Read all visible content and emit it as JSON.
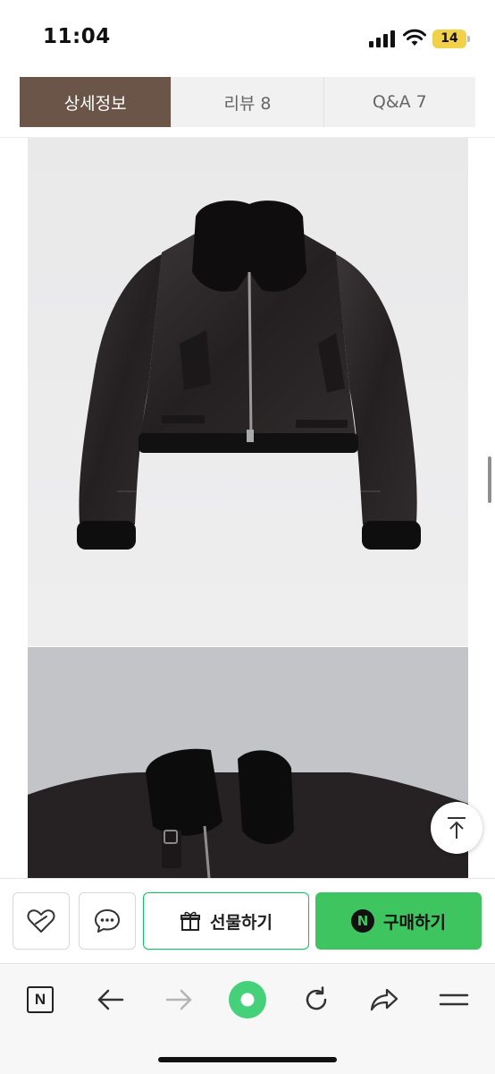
{
  "status_bar": {
    "time": "11:04",
    "battery": "14"
  },
  "tabs": [
    {
      "label": "상세정보",
      "active": true
    },
    {
      "label": "리뷰  8",
      "active": false
    },
    {
      "label": "Q&A  7",
      "active": false
    }
  ],
  "actions": {
    "like_icon": "heart-icon",
    "talk_icon": "chat-bubble-icon",
    "gift_label": "선물하기",
    "buy_badge": "N",
    "buy_label": "구매하기"
  },
  "browser_toolbar": {
    "icons": [
      "naver-n-icon",
      "back-arrow-icon",
      "forward-arrow-icon",
      "green-dot-icon",
      "refresh-icon",
      "share-icon",
      "menu-icon"
    ],
    "home_label": "N"
  },
  "colors": {
    "tab_active": "#6b5548",
    "buy_green": "#3fc55f",
    "gift_border": "#03c75a"
  }
}
